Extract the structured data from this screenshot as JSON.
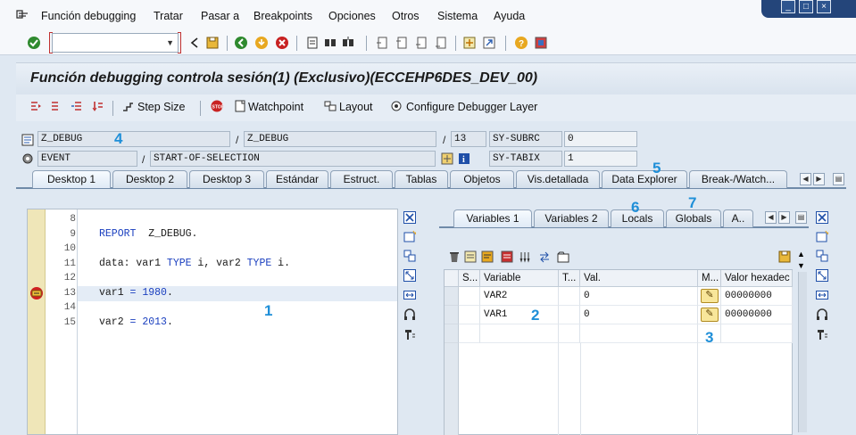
{
  "menu": [
    "Función debugging",
    "Tratar",
    "Pasar a",
    "Breakpoints",
    "Opciones",
    "Otros",
    "Sistema",
    "Ayuda"
  ],
  "window_controls": [
    "_",
    "□",
    "×"
  ],
  "command_field": {
    "value": ""
  },
  "title": "Función debugging controla sesión(1)  (Exclusivo)(ECCEHP6DES_DEV_00)",
  "app_toolbar": {
    "step_size": "Step Size",
    "watchpoint": "Watchpoint",
    "layout": "Layout",
    "configure": "Configure Debugger Layer"
  },
  "info": {
    "program": "Z_DEBUG",
    "include": "Z_DEBUG",
    "line": "13",
    "sy_subrc_label": "SY-SUBRC",
    "sy_subrc_value": "0",
    "event_type": "EVENT",
    "event_name": "START-OF-SELECTION",
    "sy_tabix_label": "SY-TABIX",
    "sy_tabix_value": "1"
  },
  "main_tabs": [
    "Desktop 1",
    "Desktop 2",
    "Desktop 3",
    "Estándar",
    "Estruct.",
    "Tablas",
    "Objetos",
    "Vis.detallada",
    "Data Explorer",
    "Break-/Watch..."
  ],
  "source": {
    "lines": [
      {
        "n": "8",
        "code": ""
      },
      {
        "n": "9",
        "code": "REPORT  Z_DEBUG."
      },
      {
        "n": "10",
        "code": ""
      },
      {
        "n": "11",
        "code": "data: var1 TYPE i, var2 TYPE i."
      },
      {
        "n": "12",
        "code": ""
      },
      {
        "n": "13",
        "code": "var1 = 1980."
      },
      {
        "n": "14",
        "code": ""
      },
      {
        "n": "15",
        "code": "var2 = 2013."
      }
    ]
  },
  "var_tabs": [
    "Variables 1",
    "Variables 2",
    "Locals",
    "Globals",
    "A.."
  ],
  "var_table": {
    "headers": [
      "S...",
      "Variable",
      "T...",
      "Val.",
      "M...",
      "Valor hexadec"
    ],
    "rows": [
      {
        "variable": "VAR2",
        "value": "0",
        "hex": "00000000"
      },
      {
        "variable": "VAR1",
        "value": "0",
        "hex": "00000000"
      }
    ]
  },
  "annotations": [
    "1",
    "2",
    "3",
    "4",
    "5",
    "6",
    "7"
  ],
  "colors": {
    "accent": "#1f8fd8",
    "window": "#24457a",
    "keyword": "#1a3fbf"
  }
}
